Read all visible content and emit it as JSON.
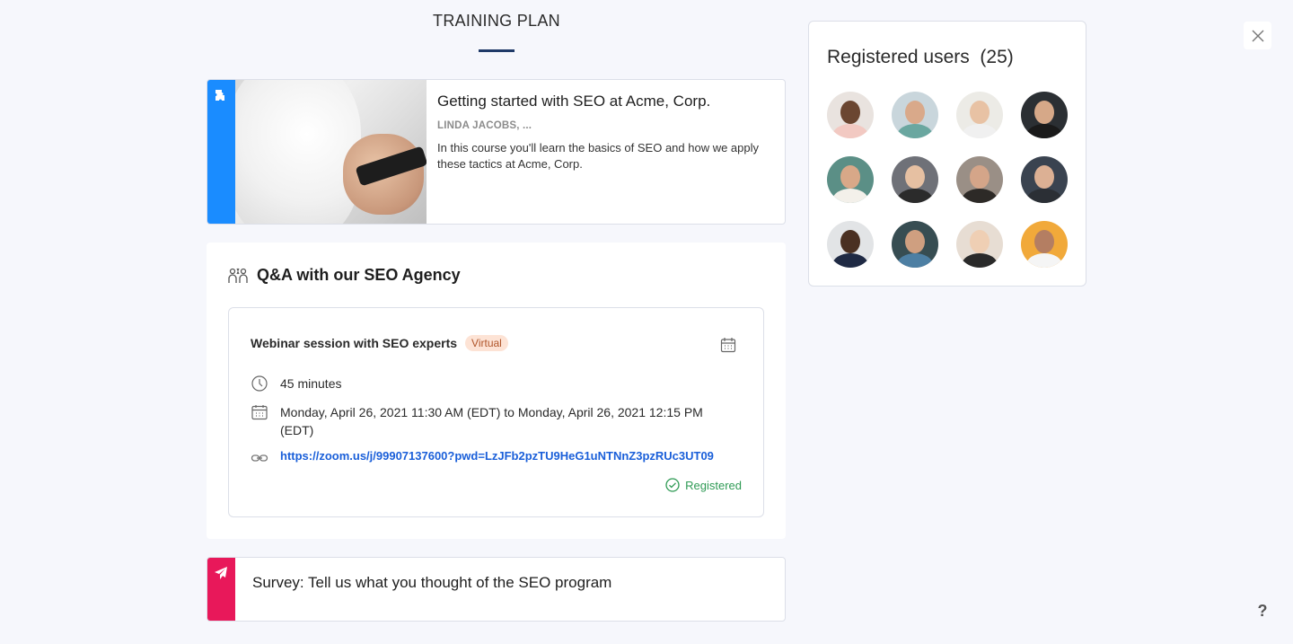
{
  "header": {
    "title": "TRAINING PLAN"
  },
  "course": {
    "title": "Getting started with SEO at Acme, Corp.",
    "author": "LINDA JACOBS, ...",
    "description": "In this course you'll learn the basics of SEO and how we apply these tactics at Acme, Corp.",
    "accent_color": "#1a8cff",
    "icon": "puzzle-icon"
  },
  "qa": {
    "title": "Q&A with our SEO Agency",
    "icon": "people-icon",
    "session": {
      "title": "Webinar session with SEO experts",
      "badge": "Virtual",
      "duration": "45 minutes",
      "datetime": "Monday, April 26, 2021 11:30 AM (EDT) to Monday, April 26, 2021 12:15 PM (EDT)",
      "link": "https://zoom.us/j/99907137600?pwd=LzJFb2pzTU9HeG1uNTNnZ3pzRUc3UT09",
      "status": "Registered",
      "status_color": "#2e9a54"
    }
  },
  "survey": {
    "title": "Survey: Tell us what you thought of the SEO program",
    "accent_color": "#e8185a",
    "icon": "paper-plane-icon"
  },
  "users": {
    "heading": "Registered users  (25)",
    "avatars": [
      {
        "bg": "#e9e3df",
        "skin": "#6b4631",
        "shirt": "#f2c9c2"
      },
      {
        "bg": "#c9d6dc",
        "skin": "#d9a98a",
        "shirt": "#6aa7a0"
      },
      {
        "bg": "#ecebe6",
        "skin": "#e8c2a4",
        "shirt": "#f0f0f0"
      },
      {
        "bg": "#2b2f33",
        "skin": "#d6a888",
        "shirt": "#1a1a1a"
      },
      {
        "bg": "#5b8f86",
        "skin": "#d8a888",
        "shirt": "#f3f0ea"
      },
      {
        "bg": "#6f7178",
        "skin": "#e6c0a2",
        "shirt": "#2b2b2b"
      },
      {
        "bg": "#9a8f86",
        "skin": "#d4a589",
        "shirt": "#2d2a27"
      },
      {
        "bg": "#3a4350",
        "skin": "#dcb094",
        "shirt": "#2b2f35"
      },
      {
        "bg": "#e2e4e6",
        "skin": "#4a3022",
        "shirt": "#1f2a44"
      },
      {
        "bg": "#374d52",
        "skin": "#cf9f80",
        "shirt": "#4d7fa3"
      },
      {
        "bg": "#e7ddd3",
        "skin": "#efcfb4",
        "shirt": "#2a2a2a"
      },
      {
        "bg": "#f1a93a",
        "skin": "#b47e62",
        "shirt": "#f5f5f5"
      }
    ]
  },
  "controls": {
    "close_icon": "close-icon",
    "help_label": "?"
  }
}
